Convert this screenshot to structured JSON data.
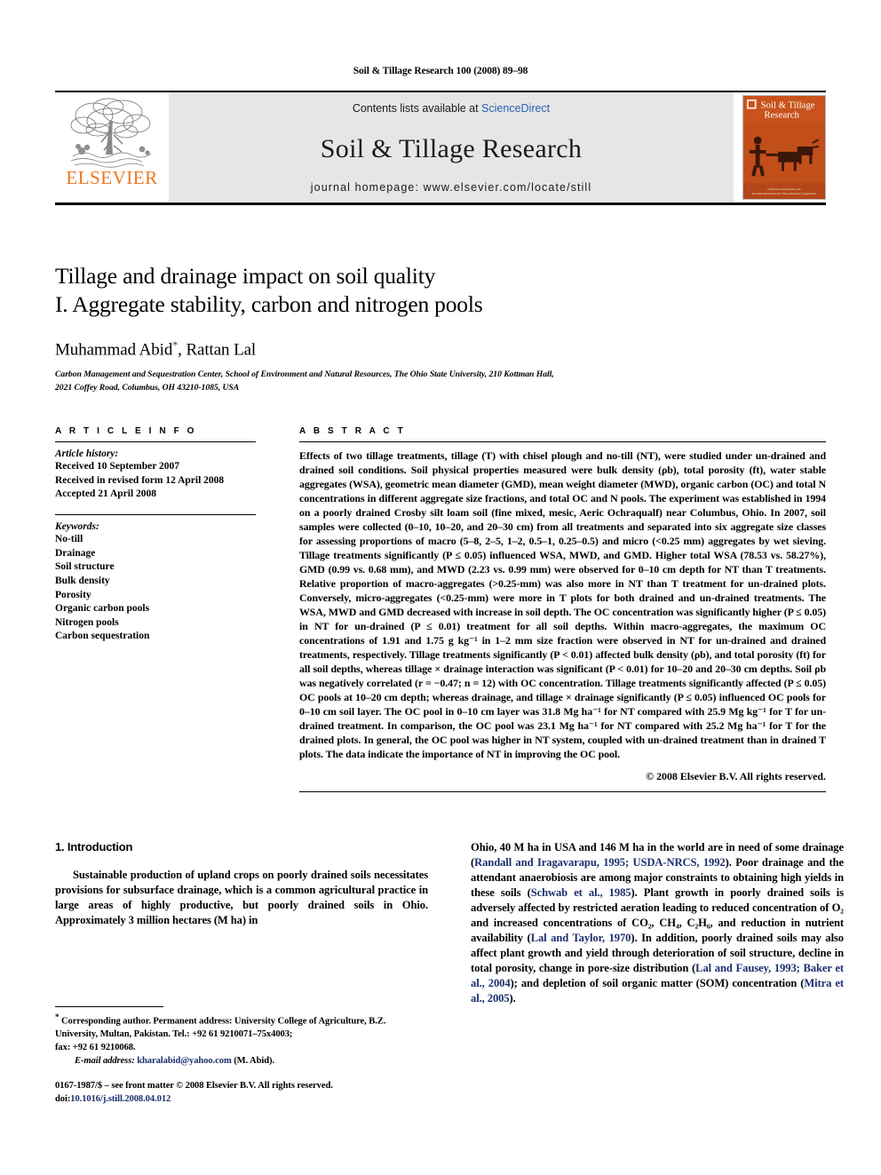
{
  "running_head": "Soil & Tillage Research 100 (2008) 89–98",
  "masthead": {
    "publisher_logo_label": "ELSEVIER",
    "contents_prefix": "Contents lists available at ",
    "contents_link": "ScienceDirect",
    "journal_name": "Soil & Tillage Research",
    "homepage": "journal homepage: www.elsevier.com/locate/still",
    "cover": {
      "line1": "Soil & Tillage",
      "line2": "Research",
      "caption": "Published in association with the International Soil and Tillage Research Organization",
      "bg_color": "#c8531b"
    }
  },
  "title": {
    "line1": "Tillage and drainage impact on soil quality",
    "line2": "I. Aggregate stability, carbon and nitrogen pools"
  },
  "authors": {
    "text": "Muhammad Abid",
    "corresponding_marker": "*",
    "text2": ", Rattan Lal"
  },
  "affiliation": {
    "line1": "Carbon Management and Sequestration Center, School of Environment and Natural Resources, The Ohio State University, 210 Kottman Hall,",
    "line2": "2021 Coffey Road, Columbus, OH 43210-1085, USA"
  },
  "article_info": {
    "heading": "A R T I C L E  I N F O",
    "history_label": "Article history:",
    "history": [
      "Received 10 September 2007",
      "Received in revised form 12 April 2008",
      "Accepted 21 April 2008"
    ],
    "keywords_label": "Keywords:",
    "keywords": [
      "No-till",
      "Drainage",
      "Soil structure",
      "Bulk density",
      "Porosity",
      "Organic carbon pools",
      "Nitrogen pools",
      "Carbon sequestration"
    ]
  },
  "abstract": {
    "heading": "A B S T R A C T",
    "body": "Effects of two tillage treatments, tillage (T) with chisel plough and no-till (NT), were studied under un-drained and drained soil conditions. Soil physical properties measured were bulk density (ρb), total porosity (ft), water stable aggregates (WSA), geometric mean diameter (GMD), mean weight diameter (MWD), organic carbon (OC) and total N concentrations in different aggregate size fractions, and total OC and N pools. The experiment was established in 1994 on a poorly drained Crosby silt loam soil (fine mixed, mesic, Aeric Ochraqualf) near Columbus, Ohio. In 2007, soil samples were collected (0–10, 10–20, and 20–30 cm) from all treatments and separated into six aggregate size classes for assessing proportions of macro (5–8, 2–5, 1–2, 0.5–1, 0.25–0.5) and micro (<0.25 mm) aggregates by wet sieving. Tillage treatments significantly (P ≤ 0.05) influenced WSA, MWD, and GMD. Higher total WSA (78.53 vs. 58.27%), GMD (0.99 vs. 0.68 mm), and MWD (2.23 vs. 0.99 mm) were observed for 0–10 cm depth for NT than T treatments. Relative proportion of macro-aggregates (>0.25-mm) was also more in NT than T treatment for un-drained plots. Conversely, micro-aggregates (<0.25-mm) were more in T plots for both drained and un-drained treatments. The WSA, MWD and GMD decreased with increase in soil depth. The OC concentration was significantly higher (P ≤ 0.05) in NT for un-drained (P ≤ 0.01) treatment for all soil depths. Within macro-aggregates, the maximum OC concentrations of 1.91 and 1.75 g kg⁻¹ in 1–2 mm size fraction were observed in NT for un-drained and drained treatments, respectively. Tillage treatments significantly (P < 0.01) affected bulk density (ρb), and total porosity (ft) for all soil depths, whereas tillage × drainage interaction was significant (P < 0.01) for 10–20 and 20–30 cm depths. Soil ρb was negatively correlated (r = −0.47; n = 12) with OC concentration. Tillage treatments significantly affected (P ≤ 0.05) OC pools at 10–20 cm depth; whereas drainage, and tillage × drainage significantly (P ≤ 0.05) influenced OC pools for 0–10 cm soil layer. The OC pool in 0–10 cm layer was 31.8 Mg ha⁻¹ for NT compared with 25.9 Mg kg⁻¹ for T for un-drained treatment. In comparison, the OC pool was 23.1 Mg ha⁻¹ for NT compared with 25.2 Mg ha⁻¹ for T for the drained plots. In general, the OC pool was higher in NT system, coupled with un-drained treatment than in drained T plots. The data indicate the importance of NT in improving the OC pool.",
    "copyright": "© 2008 Elsevier B.V. All rights reserved."
  },
  "introduction": {
    "heading": "1. Introduction",
    "left_paragraph": "Sustainable production of upland crops on poorly drained soils necessitates provisions for subsurface drainage, which is a common agricultural practice in large areas of highly productive, but poorly drained soils in Ohio. Approximately 3 million hectares (M ha) in",
    "right_paragraph_parts": [
      {
        "t": "Ohio, 40 M ha in USA and 146 M ha in the world are in need of some drainage (",
        "type": "text"
      },
      {
        "t": "Randall and Iragavarapu, 1995; USDA-NRCS, 1992",
        "type": "cite"
      },
      {
        "t": "). Poor drainage and the attendant anaerobiosis are among major constraints to obtaining high yields in these soils (",
        "type": "text"
      },
      {
        "t": "Schwab et al., 1985",
        "type": "cite"
      },
      {
        "t": "). Plant growth in poorly drained soils is adversely affected by restricted aeration leading to reduced concentration of O₂ and increased concentrations of CO₂, CH₄, C₂H₆, and reduction in nutrient availability (",
        "type": "text"
      },
      {
        "t": "Lal and Taylor, 1970",
        "type": "cite"
      },
      {
        "t": "). In addition, poorly drained soils may also affect plant growth and yield through deterioration of soil structure, decline in total porosity, change in pore-size distribution (",
        "type": "text"
      },
      {
        "t": "Lal and Fausey, 1993; Baker et al., 2004",
        "type": "cite"
      },
      {
        "t": "); and depletion of soil organic matter (SOM) concentration (",
        "type": "text"
      },
      {
        "t": "Mitra et al., 2005",
        "type": "cite"
      },
      {
        "t": ").",
        "type": "text"
      }
    ]
  },
  "footnote": {
    "marker": "*",
    "corresponding": " Corresponding author. Permanent address: University College of Agriculture, B.Z. University, Multan, Pakistan. Tel.: +92 61 9210071–75x4003;",
    "fax": "fax: +92 61 9210068.",
    "email_label": "E-mail address:",
    "email": "kharalabid@yahoo.com",
    "email_suffix": " (M. Abid)."
  },
  "imprint": {
    "issn_line": "0167-1987/$ – see front matter © 2008 Elsevier B.V. All rights reserved.",
    "doi_label": "doi:",
    "doi": "10.1016/j.still.2008.04.012"
  }
}
